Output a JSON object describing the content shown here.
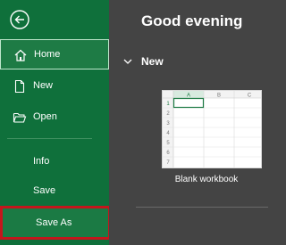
{
  "sidebar": {
    "back_icon": "back-arrow-icon",
    "items": [
      {
        "label": "Home",
        "icon": "home-icon"
      },
      {
        "label": "New",
        "icon": "new-document-icon"
      },
      {
        "label": "Open",
        "icon": "folder-open-icon"
      },
      {
        "label": "Info"
      },
      {
        "label": "Save"
      },
      {
        "label": "Save As"
      }
    ]
  },
  "main": {
    "greeting": "Good evening",
    "section_title": "New",
    "template": {
      "label": "Blank workbook",
      "columns": [
        "A",
        "B",
        "C"
      ],
      "rows": [
        "1",
        "2",
        "3",
        "4",
        "5",
        "6",
        "7"
      ]
    }
  },
  "colors": {
    "sidebar": "#0f703b",
    "main_background": "#444444",
    "highlight_border": "#c4161c"
  }
}
